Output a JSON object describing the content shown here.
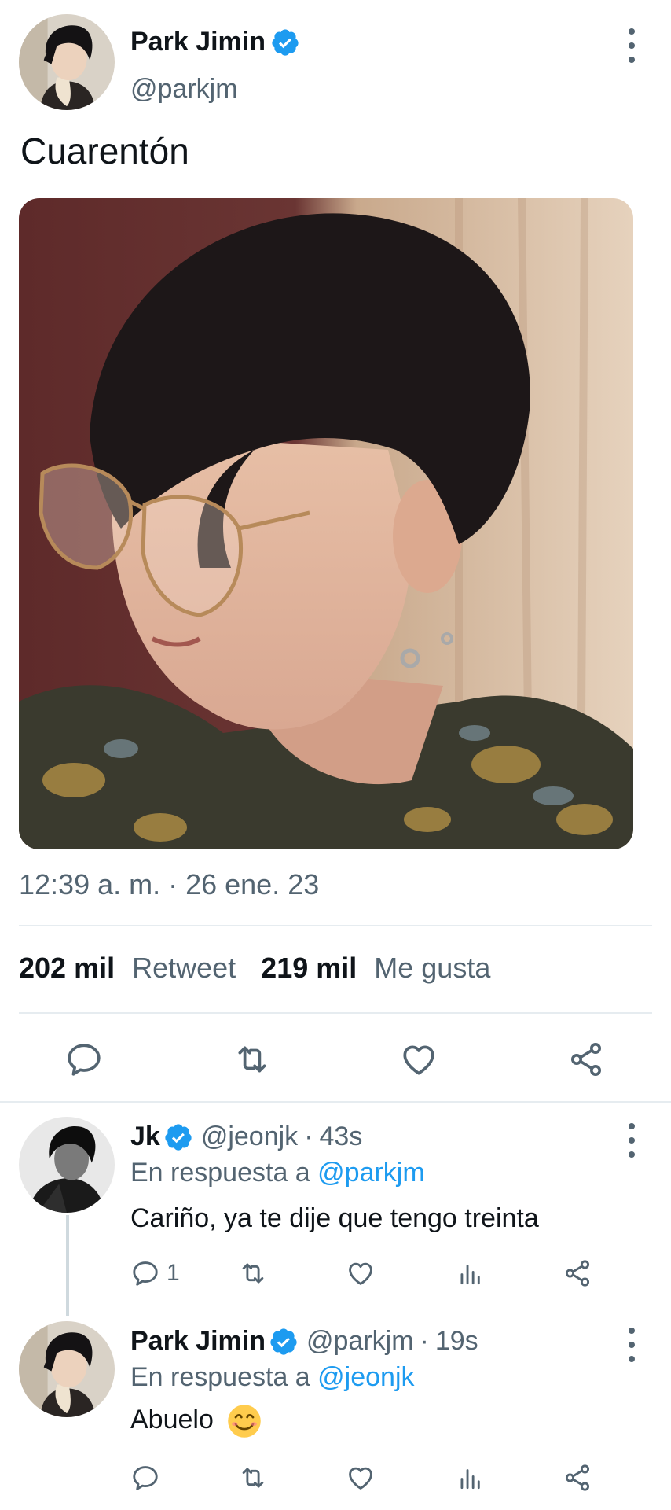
{
  "tweet": {
    "author_name": "Park Jimin",
    "author_handle": "@parkjm",
    "text": "Cuarentón",
    "timestamp": "12:39 a. m. · 26 ene. 23",
    "retweets_count": "202 mil",
    "retweets_label": "Retweet",
    "likes_count": "219 mil",
    "likes_label": "Me gusta"
  },
  "replies": [
    {
      "author_name": "Jk",
      "author_handle": "@jeonjk",
      "separator": "·",
      "time": "43s",
      "reply_to_prefix": "En respuesta a",
      "reply_to_handle": "@parkjm",
      "text": "Cariño, ya te dije que tengo treinta",
      "reply_count": "1"
    },
    {
      "author_name": "Park Jimin",
      "author_handle": "@parkjm",
      "separator": "·",
      "time": "19s",
      "reply_to_prefix": "En respuesta a",
      "reply_to_handle": "@jeonjk",
      "text": "Abuelo",
      "reply_count": ""
    }
  ],
  "colors": {
    "verified_blue": "#1d9bf0",
    "secondary_text": "#536471",
    "divider": "#e6ecf0"
  },
  "icons": [
    "verified-badge-icon",
    "more-options-icon",
    "reply-icon",
    "retweet-icon",
    "like-icon",
    "share-icon",
    "analytics-icon",
    "smiling-emoji-icon"
  ]
}
